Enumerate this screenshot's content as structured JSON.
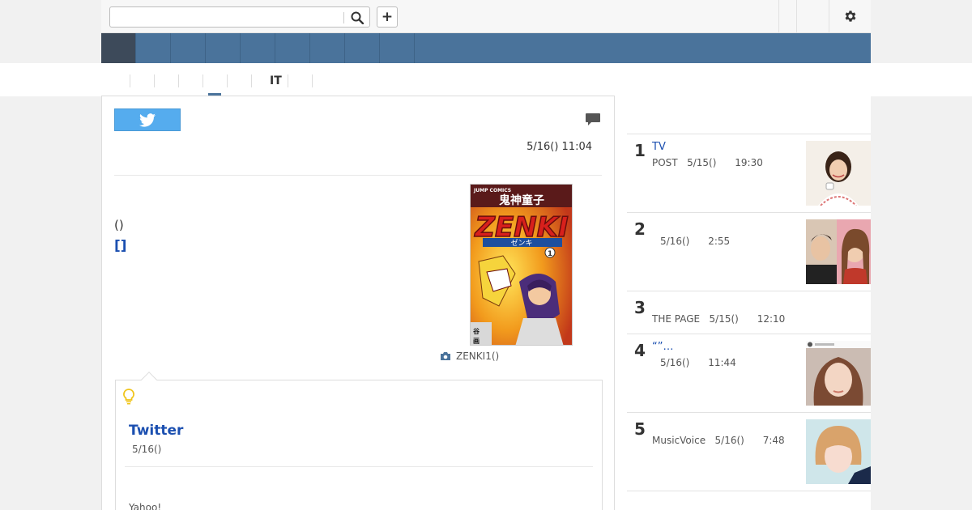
{
  "search": {
    "placeholder": "",
    "value": ""
  },
  "toolbar": {
    "plus_label": "+"
  },
  "nav": {
    "items": [
      "",
      "",
      "",
      "",
      "",
      "",
      "",
      "",
      ""
    ]
  },
  "subtabs": [
    "",
    "",
    "",
    "",
    "",
    "IT",
    "",
    ""
  ],
  "article": {
    "date": "5/16() 11:04",
    "paren_text": "()",
    "bracket_link": "[]",
    "image_caption": "ZENKI1()",
    "cover": {
      "series_label": "JUMP COMICS",
      "kanji_title": "鬼神童子",
      "title": "ZENKI",
      "subtitle": "ゼンキ",
      "volume": "1"
    }
  },
  "related": {
    "title": "Twitter",
    "date": "5/16()",
    "source": "Yahoo!"
  },
  "ranking": [
    {
      "rank": "1",
      "title": "TV",
      "meta": "POST   5/15()      19:30"
    },
    {
      "rank": "2",
      "title": "",
      "meta": "5/16()      2:55"
    },
    {
      "rank": "3",
      "title": "",
      "meta": "THE PAGE   5/15()      12:10"
    },
    {
      "rank": "4",
      "title": "“”…",
      "meta": "5/16()      11:44"
    },
    {
      "rank": "5",
      "title": "",
      "meta": "MusicVoice   5/16()      7:48"
    }
  ],
  "colors": {
    "nav_blue": "#4a739b",
    "nav_active": "#3d4a5a",
    "link_blue": "#1b4fb0",
    "twitter_blue": "#55acee",
    "bulb_yellow": "#f0c419"
  },
  "icons": {
    "search": "search-icon",
    "gear": "gear-icon",
    "twitter": "twitter-bird-icon",
    "comment": "comment-icon",
    "camera": "camera-icon",
    "bulb": "lightbulb-icon"
  }
}
